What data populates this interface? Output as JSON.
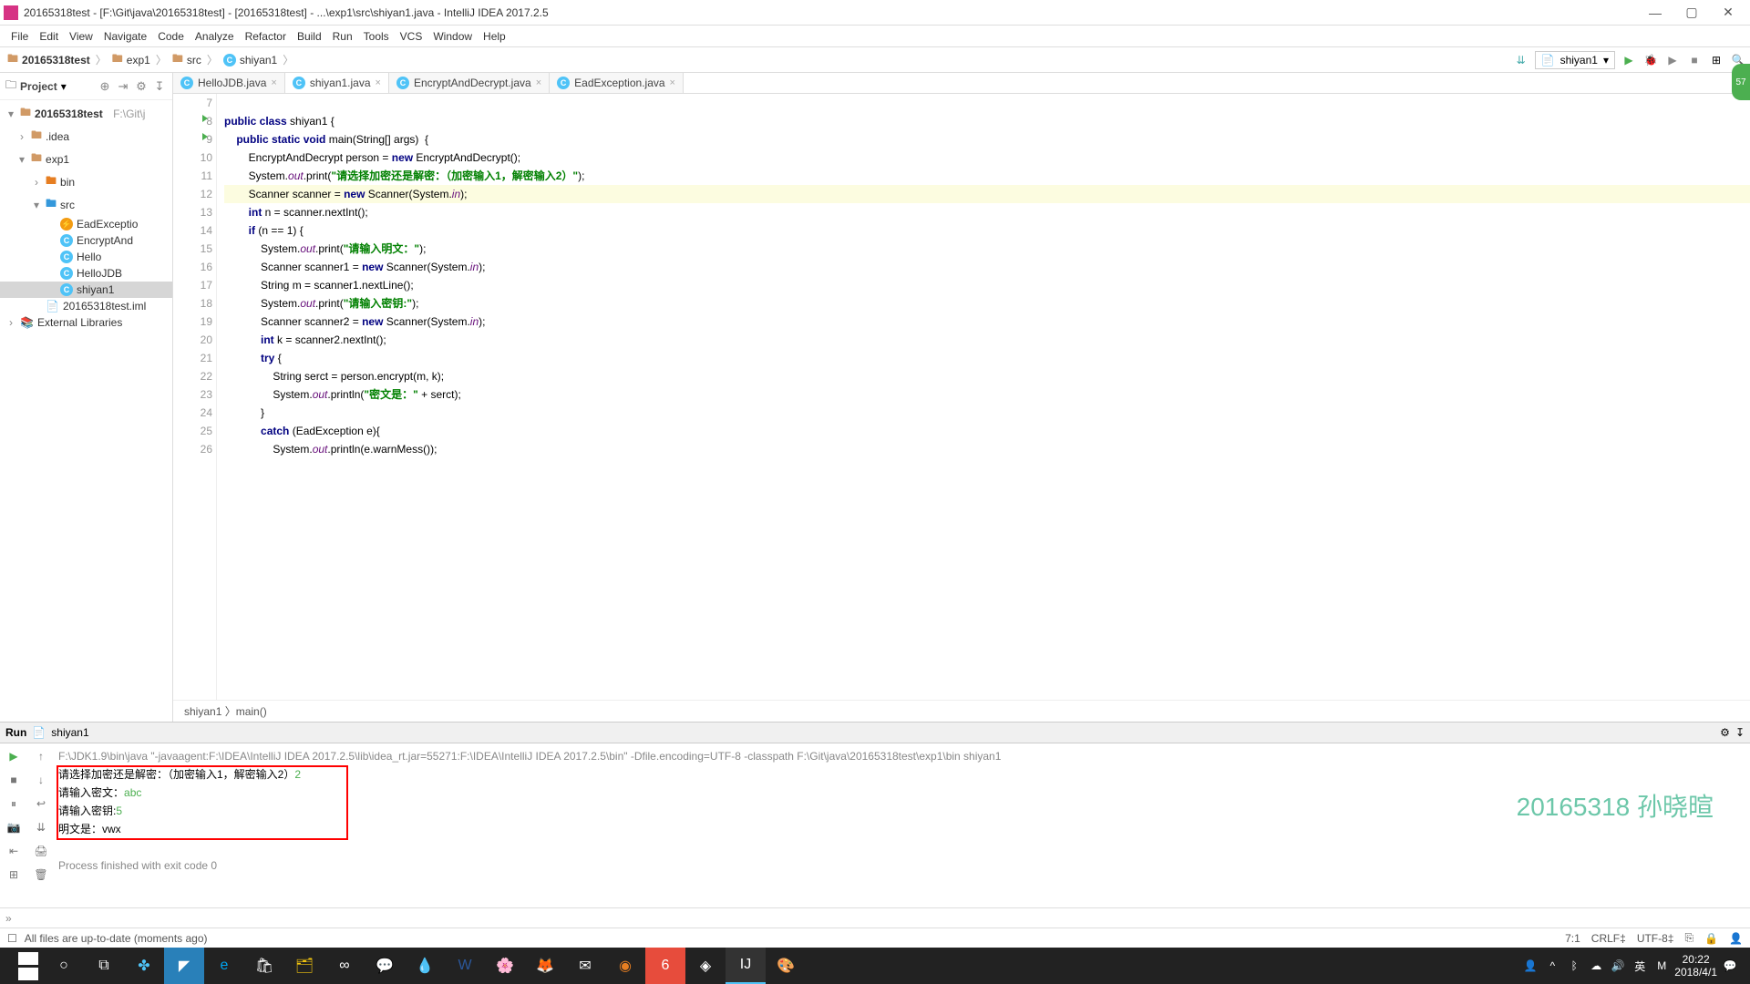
{
  "title": "20165318test - [F:\\Git\\java\\20165318test] - [20165318test] - ...\\exp1\\src\\shiyan1.java - IntelliJ IDEA 2017.2.5",
  "menu": [
    "File",
    "Edit",
    "View",
    "Navigate",
    "Code",
    "Analyze",
    "Refactor",
    "Build",
    "Run",
    "Tools",
    "VCS",
    "Window",
    "Help"
  ],
  "crumbs": [
    "20165318test",
    "exp1",
    "src",
    "shiyan1"
  ],
  "run_config": "shiyan1",
  "badge": "57",
  "proj_title": "Project",
  "tree": {
    "root": "20165318test",
    "root_path": "F:\\Git\\j",
    "idea": ".idea",
    "exp1": "exp1",
    "bin": "bin",
    "src": "src",
    "eadex": "EadExceptio",
    "encdec": "EncryptAnd",
    "hello": "Hello",
    "hellojdb": "HelloJDB",
    "shiyan1": "shiyan1",
    "iml": "20165318test.iml",
    "extlib": "External Libraries"
  },
  "tabs": [
    {
      "name": "HelloJDB.java",
      "active": false
    },
    {
      "name": "shiyan1.java",
      "active": true
    },
    {
      "name": "EncryptAndDecrypt.java",
      "active": false
    },
    {
      "name": "EadException.java",
      "active": false
    }
  ],
  "gutter_start": 7,
  "gutter_end": 26,
  "run_arrows": [
    8,
    9
  ],
  "highlighted_line": 12,
  "code_trail": "shiyan1 〉main()",
  "run_tab": "Run",
  "run_name": "shiyan1",
  "console": {
    "cmd": "F:\\JDK1.9\\bin\\java \"-javaagent:F:\\IDEA\\IntelliJ IDEA 2017.2.5\\lib\\idea_rt.jar=55271:F:\\IDEA\\IntelliJ IDEA 2017.2.5\\bin\" -Dfile.encoding=UTF-8 -classpath F:\\Git\\java\\20165318test\\exp1\\bin shiyan1",
    "l1p": "请选择加密还是解密：（加密输入1，解密输入2）",
    "l1i": "2",
    "l2p": "请输入密文：",
    "l2i": "abc",
    "l3p": "请输入密钥:",
    "l3i": "5",
    "l4": "明文是：vwx",
    "exit": "Process finished with exit code 0"
  },
  "watermark": "20165318 孙晓暄",
  "tw_btm": "»",
  "status": {
    "left": "All files are up-to-date (moments ago)",
    "pos": "7:1",
    "crlf": "CRLF‡",
    "enc": "UTF-8‡",
    "git": "⎘"
  },
  "tray": {
    "time": "20:22",
    "date": "2018/4/1",
    "lang": "英"
  }
}
